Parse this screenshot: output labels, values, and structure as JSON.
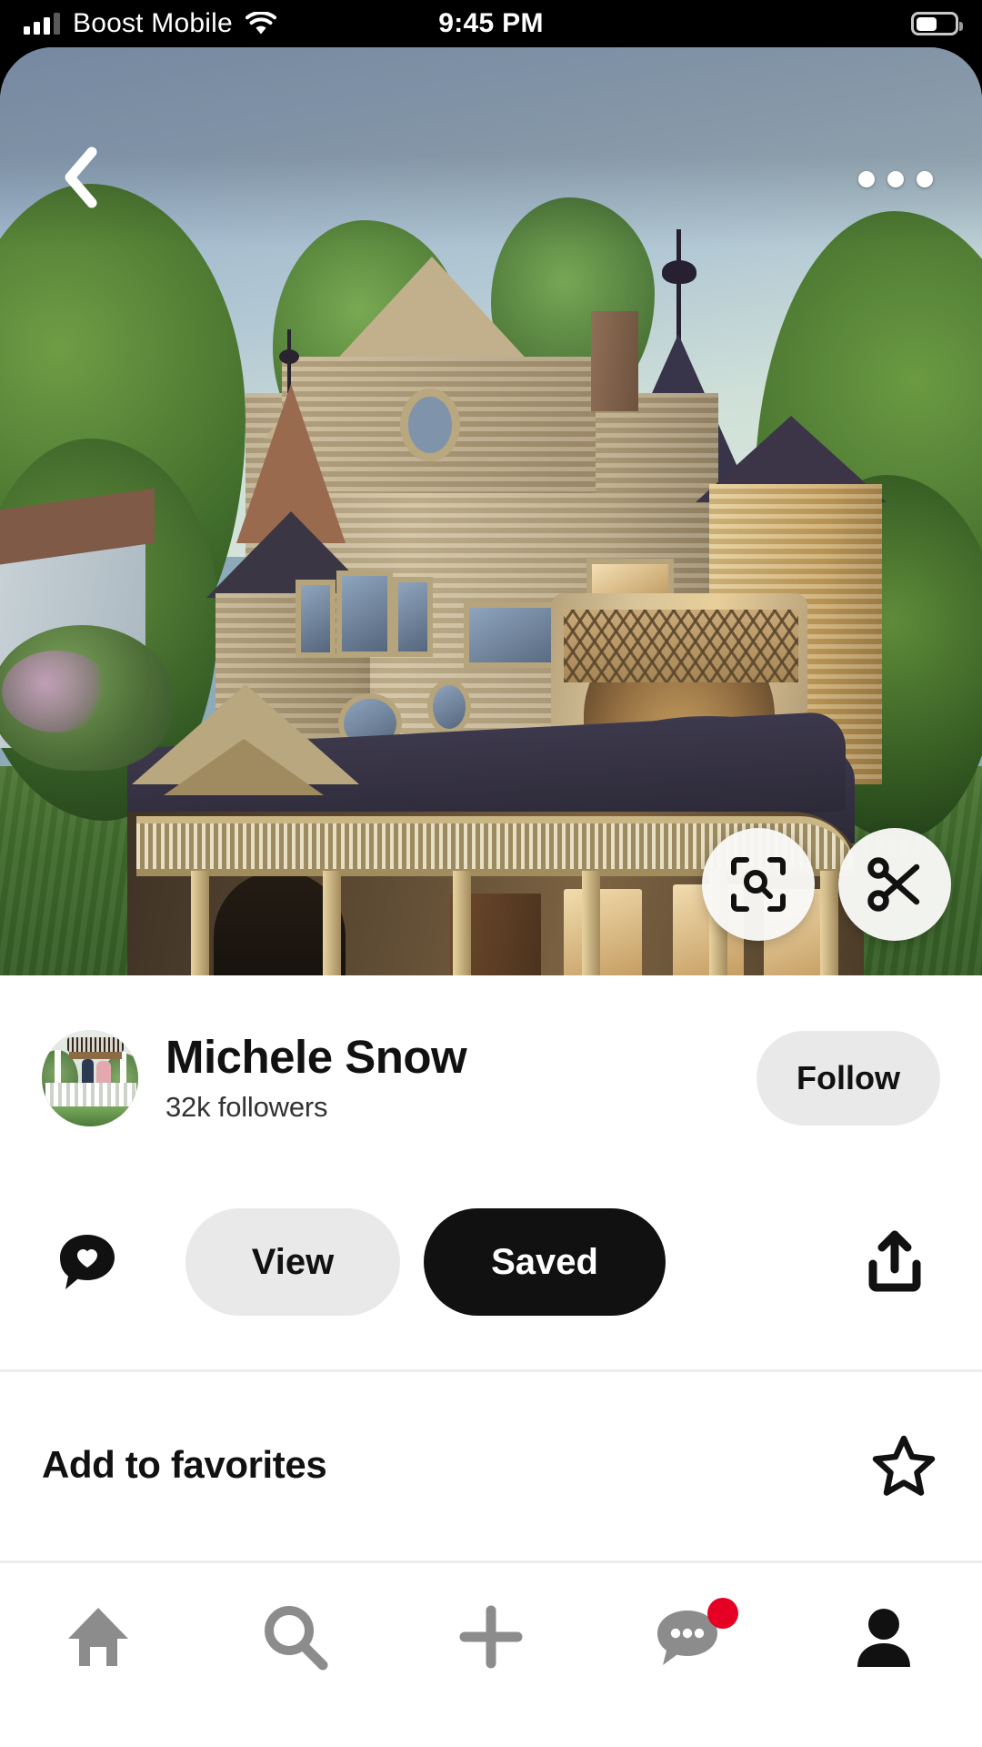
{
  "status_bar": {
    "carrier": "Boost Mobile",
    "time": "9:45 PM",
    "signal_bars_total": 4,
    "signal_bars_filled": 3,
    "wifi_icon": "wifi-icon",
    "battery_percent": 55,
    "background_color": "#000000",
    "text_color": "#ffffff"
  },
  "hero": {
    "image_description": "Victorian Queen Anne house with turrets, wraparound porch, at dusk with green lawn and trees",
    "back_icon": "chevron-left-icon",
    "more_icon": "more-horizontal-icon",
    "actions": [
      {
        "name": "visual-search",
        "icon": "lens-search-icon"
      },
      {
        "name": "crop",
        "icon": "scissors-icon"
      }
    ]
  },
  "author": {
    "name": "Michele Snow",
    "followers": "32k followers",
    "avatar_description": "Couple standing on a white Victorian porch surrounded by greenery",
    "follow_label": "Follow",
    "follow_bg": "#e9e9e9"
  },
  "actions": {
    "comment_icon": "heart-comment-bubble-icon",
    "view_label": "View",
    "saved_label": "Saved",
    "share_icon": "share-upload-icon",
    "view_bg": "#e9e9e9",
    "saved_bg": "#111111",
    "saved_text_color": "#ffffff"
  },
  "favorites": {
    "label": "Add to favorites",
    "icon": "star-outline-icon"
  },
  "tabbar": {
    "items": [
      {
        "name": "home",
        "icon": "home-icon",
        "active": false,
        "badge": false
      },
      {
        "name": "search",
        "icon": "search-icon",
        "active": false,
        "badge": false
      },
      {
        "name": "create",
        "icon": "plus-icon",
        "active": false,
        "badge": false
      },
      {
        "name": "updates",
        "icon": "chat-bubble-icon",
        "active": false,
        "badge": true
      },
      {
        "name": "profile",
        "icon": "person-icon",
        "active": true,
        "badge": false
      }
    ],
    "inactive_color": "#8c8c8c",
    "active_color": "#111111",
    "badge_color": "#e60023"
  }
}
